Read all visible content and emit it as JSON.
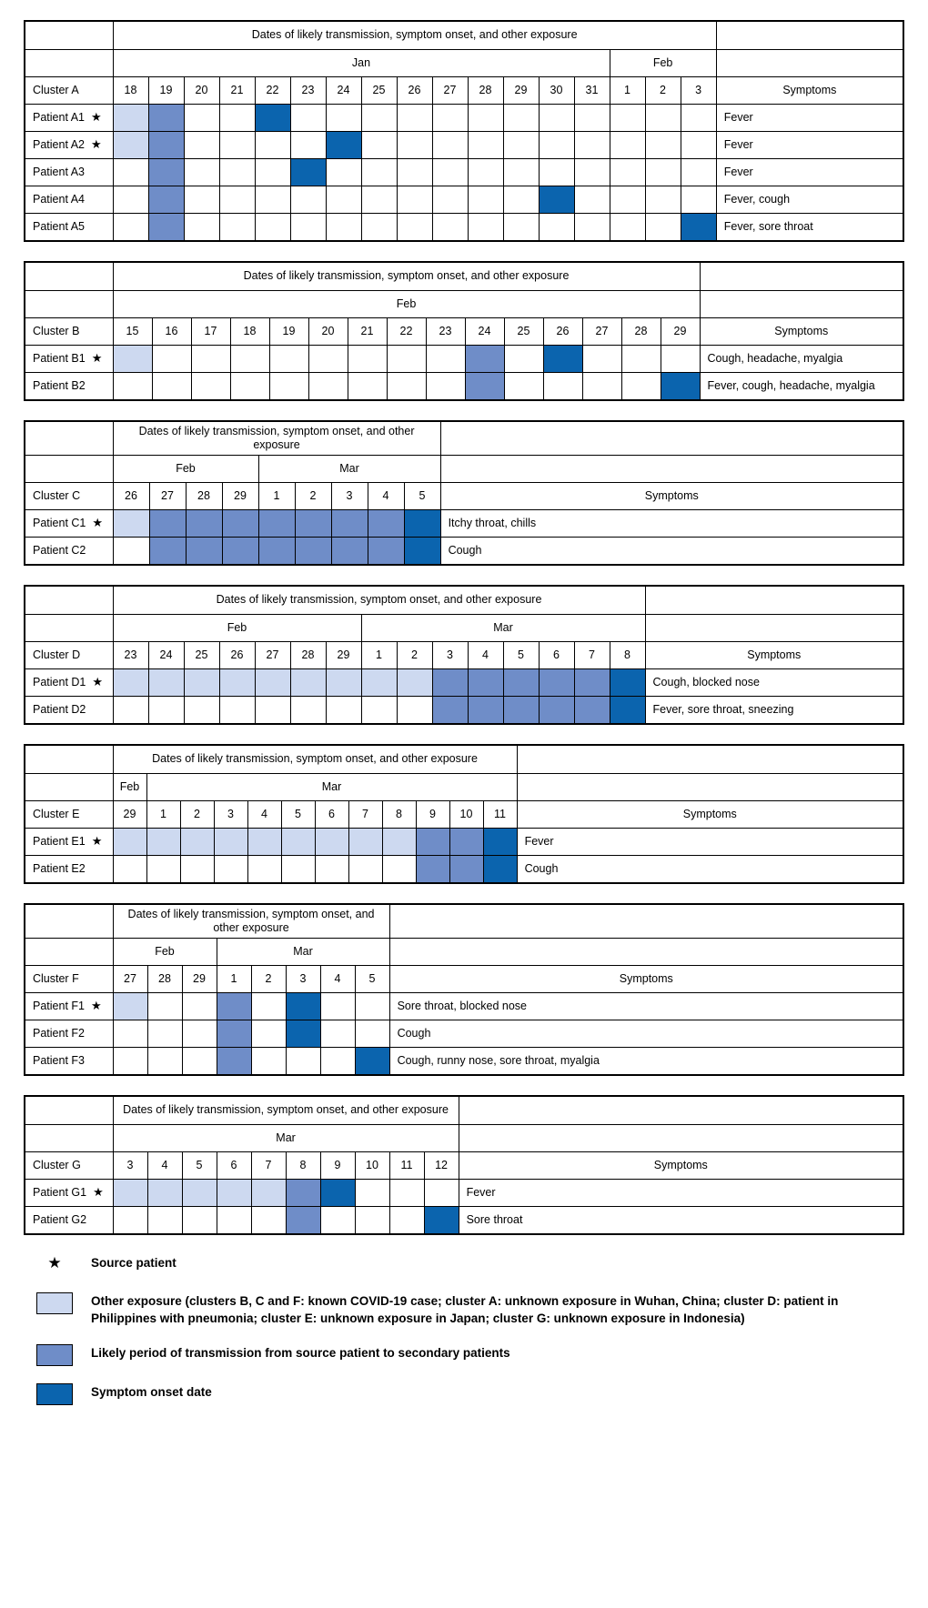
{
  "figure": {
    "header_title": "Dates of likely transmission, symptom onset, and other exposure",
    "symptoms_header": "Symptoms"
  },
  "colors": {
    "exposure": "#cdd9f0",
    "transmission": "#6f8dc8",
    "onset": "#0b64ae"
  },
  "clusters": [
    {
      "name": "Cluster A",
      "header_title": "Dates of likely transmission, symptom onset, and other exposure",
      "months": [
        {
          "label": "Jan",
          "span": 14
        },
        {
          "label": "Feb",
          "span": 3
        }
      ],
      "days": [
        "18",
        "19",
        "20",
        "21",
        "22",
        "23",
        "24",
        "25",
        "26",
        "27",
        "28",
        "29",
        "30",
        "31",
        "1",
        "2",
        "3"
      ],
      "rows": [
        {
          "patient": "Patient A1",
          "source": true,
          "symptoms": "Fever",
          "cells": [
            "exposure",
            "transmission",
            "",
            "",
            "onset",
            "",
            "",
            "",
            "",
            "",
            "",
            "",
            "",
            "",
            "",
            "",
            ""
          ]
        },
        {
          "patient": "Patient A2",
          "source": true,
          "symptoms": "Fever",
          "cells": [
            "exposure",
            "transmission",
            "",
            "",
            "",
            "",
            "onset",
            "",
            "",
            "",
            "",
            "",
            "",
            "",
            "",
            "",
            ""
          ]
        },
        {
          "patient": "Patient A3",
          "source": false,
          "symptoms": "Fever",
          "cells": [
            "",
            "transmission",
            "",
            "",
            "",
            "onset",
            "",
            "",
            "",
            "",
            "",
            "",
            "",
            "",
            "",
            "",
            ""
          ]
        },
        {
          "patient": "Patient A4",
          "source": false,
          "symptoms": "Fever, cough",
          "cells": [
            "",
            "transmission",
            "",
            "",
            "",
            "",
            "",
            "",
            "",
            "",
            "",
            "",
            "onset",
            "",
            "",
            "",
            ""
          ]
        },
        {
          "patient": "Patient A5",
          "source": false,
          "symptoms": "Fever, sore throat",
          "cells": [
            "",
            "transmission",
            "",
            "",
            "",
            "",
            "",
            "",
            "",
            "",
            "",
            "",
            "",
            "",
            "",
            "",
            "onset"
          ]
        }
      ]
    },
    {
      "name": "Cluster B",
      "header_title": "Dates of likely transmission, symptom onset, and other exposure",
      "months": [
        {
          "label": "Feb",
          "span": 15
        }
      ],
      "days": [
        "15",
        "16",
        "17",
        "18",
        "19",
        "20",
        "21",
        "22",
        "23",
        "24",
        "25",
        "26",
        "27",
        "28",
        "29"
      ],
      "rows": [
        {
          "patient": "Patient B1",
          "source": true,
          "symptoms": "Cough, headache, myalgia",
          "cells": [
            "exposure",
            "",
            "",
            "",
            "",
            "",
            "",
            "",
            "",
            "transmission",
            "",
            "onset",
            "",
            "",
            ""
          ]
        },
        {
          "patient": "Patient B2",
          "source": false,
          "symptoms": "Fever, cough, headache, myalgia",
          "cells": [
            "",
            "",
            "",
            "",
            "",
            "",
            "",
            "",
            "",
            "transmission",
            "",
            "",
            "",
            "",
            "onset"
          ]
        }
      ]
    },
    {
      "name": "Cluster C",
      "header_title": "Dates of likely transmission, symptom onset, and other exposure",
      "months": [
        {
          "label": "Feb",
          "span": 4
        },
        {
          "label": "Mar",
          "span": 5
        }
      ],
      "days": [
        "26",
        "27",
        "28",
        "29",
        "1",
        "2",
        "3",
        "4",
        "5"
      ],
      "rows": [
        {
          "patient": "Patient C1",
          "source": true,
          "symptoms": "Itchy throat, chills",
          "cells": [
            "exposure",
            "transmission",
            "transmission",
            "transmission",
            "transmission",
            "transmission",
            "transmission",
            "transmission",
            "onset"
          ]
        },
        {
          "patient": "Patient C2",
          "source": false,
          "symptoms": "Cough",
          "cells": [
            "",
            "transmission",
            "transmission",
            "transmission",
            "transmission",
            "transmission",
            "transmission",
            "transmission",
            "onset"
          ]
        }
      ]
    },
    {
      "name": "Cluster D",
      "header_title": "Dates of likely transmission, symptom onset, and other exposure",
      "months": [
        {
          "label": "Feb",
          "span": 7
        },
        {
          "label": "Mar",
          "span": 8
        }
      ],
      "days": [
        "23",
        "24",
        "25",
        "26",
        "27",
        "28",
        "29",
        "1",
        "2",
        "3",
        "4",
        "5",
        "6",
        "7",
        "8"
      ],
      "rows": [
        {
          "patient": "Patient D1",
          "source": true,
          "symptoms": "Cough, blocked nose",
          "cells": [
            "exposure",
            "exposure",
            "exposure",
            "exposure",
            "exposure",
            "exposure",
            "exposure",
            "exposure",
            "exposure",
            "transmission",
            "transmission",
            "transmission",
            "transmission",
            "transmission",
            "onset"
          ]
        },
        {
          "patient": "Patient D2",
          "source": false,
          "symptoms": "Fever, sore throat, sneezing",
          "cells": [
            "",
            "",
            "",
            "",
            "",
            "",
            "",
            "",
            "",
            "transmission",
            "transmission",
            "transmission",
            "transmission",
            "transmission",
            "onset"
          ]
        }
      ]
    },
    {
      "name": "Cluster E",
      "header_title": "Dates of likely transmission, symptom onset, and other exposure",
      "months": [
        {
          "label": "Feb",
          "span": 1
        },
        {
          "label": "Mar",
          "span": 11
        }
      ],
      "days": [
        "29",
        "1",
        "2",
        "3",
        "4",
        "5",
        "6",
        "7",
        "8",
        "9",
        "10",
        "11"
      ],
      "rows": [
        {
          "patient": "Patient E1",
          "source": true,
          "symptoms": "Fever",
          "cells": [
            "exposure",
            "exposure",
            "exposure",
            "exposure",
            "exposure",
            "exposure",
            "exposure",
            "exposure",
            "exposure",
            "transmission",
            "transmission",
            "onset"
          ]
        },
        {
          "patient": "Patient E2",
          "source": false,
          "symptoms": "Cough",
          "cells": [
            "",
            "",
            "",
            "",
            "",
            "",
            "",
            "",
            "",
            "transmission",
            "transmission",
            "onset"
          ]
        }
      ]
    },
    {
      "name": "Cluster F",
      "header_title": "Dates of likely transmission, symptom onset, and other exposure",
      "months": [
        {
          "label": "Feb",
          "span": 3
        },
        {
          "label": "Mar",
          "span": 5
        }
      ],
      "days": [
        "27",
        "28",
        "29",
        "1",
        "2",
        "3",
        "4",
        "5"
      ],
      "rows": [
        {
          "patient": "Patient F1",
          "source": true,
          "symptoms": "Sore throat, blocked nose",
          "cells": [
            "exposure",
            "",
            "",
            "transmission",
            "",
            "onset",
            "",
            ""
          ]
        },
        {
          "patient": "Patient F2",
          "source": false,
          "symptoms": "Cough",
          "cells": [
            "",
            "",
            "",
            "transmission",
            "",
            "onset",
            "",
            ""
          ]
        },
        {
          "patient": "Patient F3",
          "source": false,
          "symptoms": "Cough, runny nose, sore throat, myalgia",
          "cells": [
            "",
            "",
            "",
            "transmission",
            "",
            "",
            "",
            "onset"
          ]
        }
      ]
    },
    {
      "name": "Cluster G",
      "header_title": "Dates of likely transmission, symptom onset, and other exposure",
      "months": [
        {
          "label": "Mar",
          "span": 10
        }
      ],
      "days": [
        "3",
        "4",
        "5",
        "6",
        "7",
        "8",
        "9",
        "10",
        "11",
        "12"
      ],
      "rows": [
        {
          "patient": "Patient G1",
          "source": true,
          "symptoms": "Fever",
          "cells": [
            "exposure",
            "exposure",
            "exposure",
            "exposure",
            "exposure",
            "transmission",
            "onset",
            "",
            "",
            ""
          ]
        },
        {
          "patient": "Patient G2",
          "source": false,
          "symptoms": "Sore throat",
          "cells": [
            "",
            "",
            "",
            "",
            "",
            "transmission",
            "",
            "",
            "",
            "onset"
          ]
        }
      ]
    }
  ],
  "legend": {
    "star_symbol": "★",
    "items": [
      {
        "kind": "star",
        "label": "Source patient"
      },
      {
        "kind": "swatch",
        "swatch": "exposure",
        "label": "Other exposure (clusters B, C and F: known COVID-19 case; cluster A: unknown exposure in Wuhan, China; cluster D: patient in Philippines with pneumonia; cluster E: unknown exposure in Japan; cluster G: unknown exposure in Indonesia)"
      },
      {
        "kind": "swatch",
        "swatch": "transmission",
        "label": "Likely period of transmission from source patient to secondary patients"
      },
      {
        "kind": "swatch",
        "swatch": "onset",
        "label": "Symptom onset date"
      }
    ]
  }
}
